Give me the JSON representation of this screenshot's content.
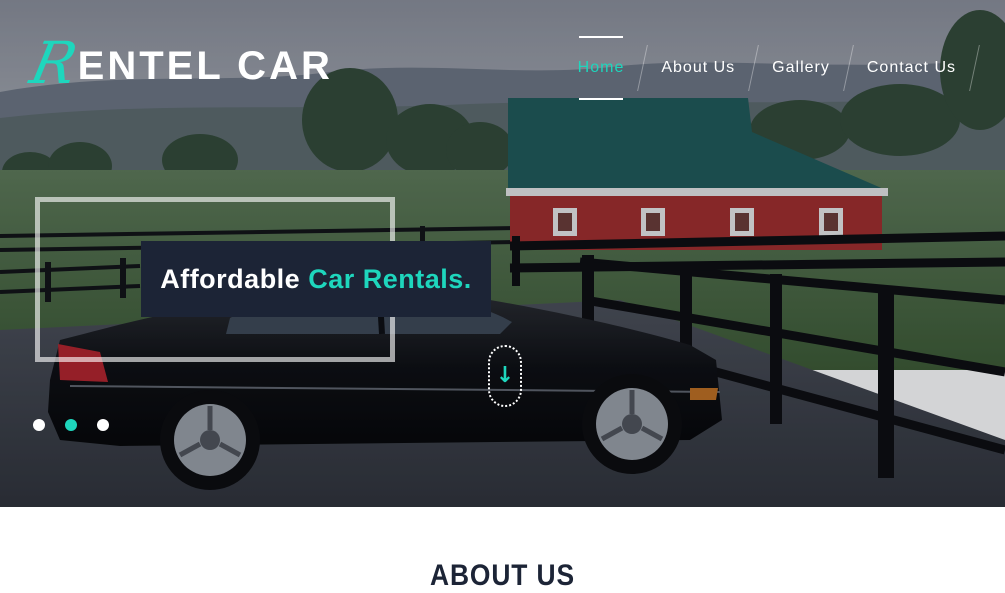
{
  "logo": {
    "initial": "R",
    "rest": "ENTEL CAR"
  },
  "nav": {
    "items": [
      {
        "label": "Home",
        "active": true
      },
      {
        "label": "About Us",
        "active": false
      },
      {
        "label": "Gallery",
        "active": false
      },
      {
        "label": "Contact Us",
        "active": false
      }
    ]
  },
  "hero": {
    "caption_main": "Affordable ",
    "caption_accent": "Car Rentals.",
    "scroll_icon": "arrow-down-icon",
    "slides": 3,
    "active_slide": 2
  },
  "about": {
    "title": "ABOUT US"
  },
  "colors": {
    "accent": "#1ed6bd",
    "dark": "#1c2436",
    "barn": "#b8312f",
    "roof": "#1d5d5a"
  }
}
